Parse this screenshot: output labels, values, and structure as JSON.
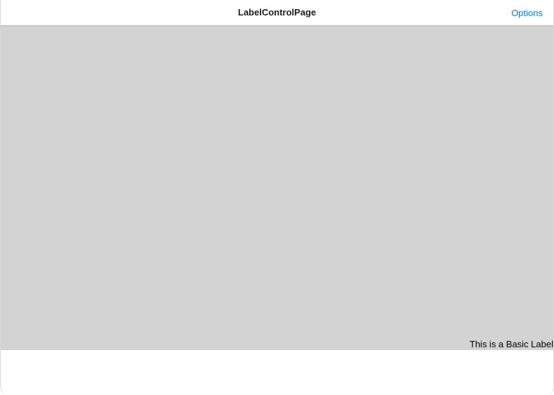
{
  "navbar": {
    "title": "LabelControlPage",
    "options_label": "Options"
  },
  "content": {
    "basic_label": "This is a Basic Label"
  },
  "colors": {
    "accent": "#007aff",
    "content_background": "#d3d3d3",
    "page_background": "#ffffff"
  }
}
